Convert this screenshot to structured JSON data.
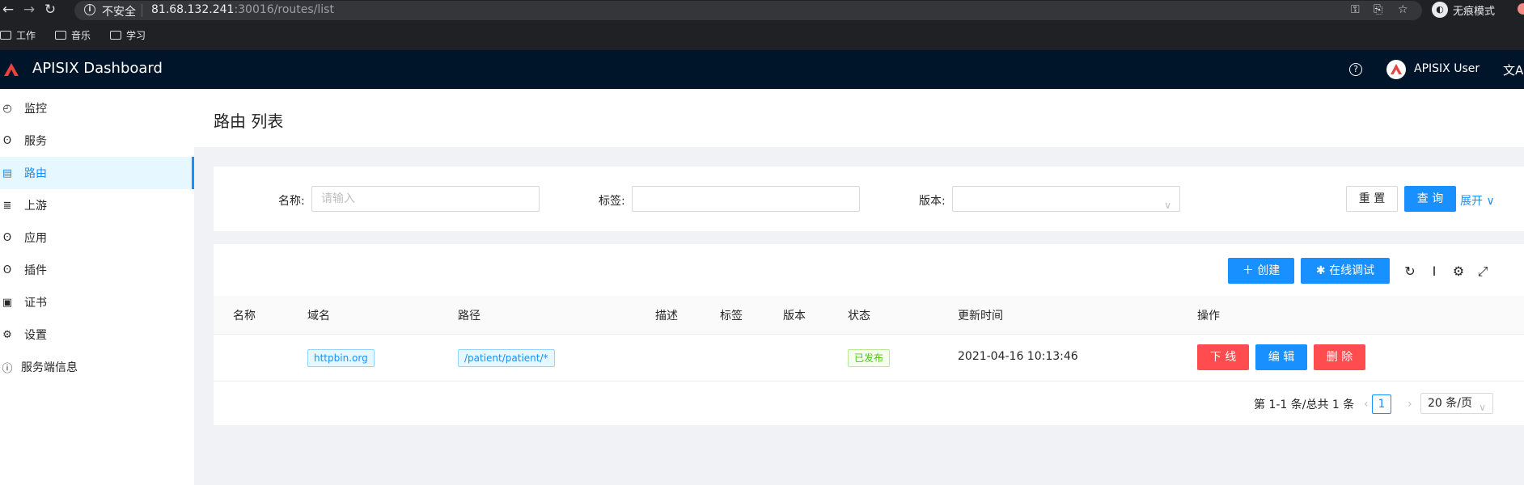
{
  "browser": {
    "insecure_label": "不安全",
    "url_host": "81.68.132.241",
    "url_rest": ":30016/routes/list",
    "incognito_label": "无痕模式",
    "bookmarks": [
      "工作",
      "音乐",
      "学习"
    ]
  },
  "header": {
    "title": "APISIX Dashboard",
    "user_name": "APISIX User",
    "brand_color": "#e8433e"
  },
  "sidebar": {
    "items": [
      {
        "label": "监控",
        "icon": "dashboard-icon"
      },
      {
        "label": "服务",
        "icon": "service-icon"
      },
      {
        "label": "路由",
        "icon": "route-icon",
        "active": true
      },
      {
        "label": "上游",
        "icon": "upstream-icon"
      },
      {
        "label": "应用",
        "icon": "consumer-icon"
      },
      {
        "label": "插件",
        "icon": "plugin-icon"
      },
      {
        "label": "证书",
        "icon": "certificate-icon"
      },
      {
        "label": "设置",
        "icon": "gear-icon"
      },
      {
        "label": "服务端信息",
        "icon": "info-icon"
      }
    ]
  },
  "page": {
    "title": "路由 列表"
  },
  "search": {
    "name_label": "名称:",
    "name_placeholder": "请输入",
    "labels_label": "标签:",
    "version_label": "版本:",
    "reset_label": "重 置",
    "query_label": "查 询",
    "expand_label": "展开"
  },
  "toolbar": {
    "create_label": "创建",
    "debug_label": "在线调试"
  },
  "table": {
    "columns": [
      "名称",
      "域名",
      "路径",
      "描述",
      "标签",
      "版本",
      "状态",
      "更新时间",
      "操作"
    ],
    "rows": [
      {
        "name": "",
        "host": "httpbin.org",
        "path": "/patient/patient/*",
        "desc": "",
        "labels": "",
        "version": "",
        "status": "已发布",
        "updated": "2021-04-16 10:13:46",
        "actions": {
          "offline": "下 线",
          "edit": "编 辑",
          "delete": "删 除"
        }
      }
    ]
  },
  "pagination": {
    "total": "第 1-1 条/总共 1 条",
    "current_page": "1",
    "page_size": "20 条/页"
  }
}
